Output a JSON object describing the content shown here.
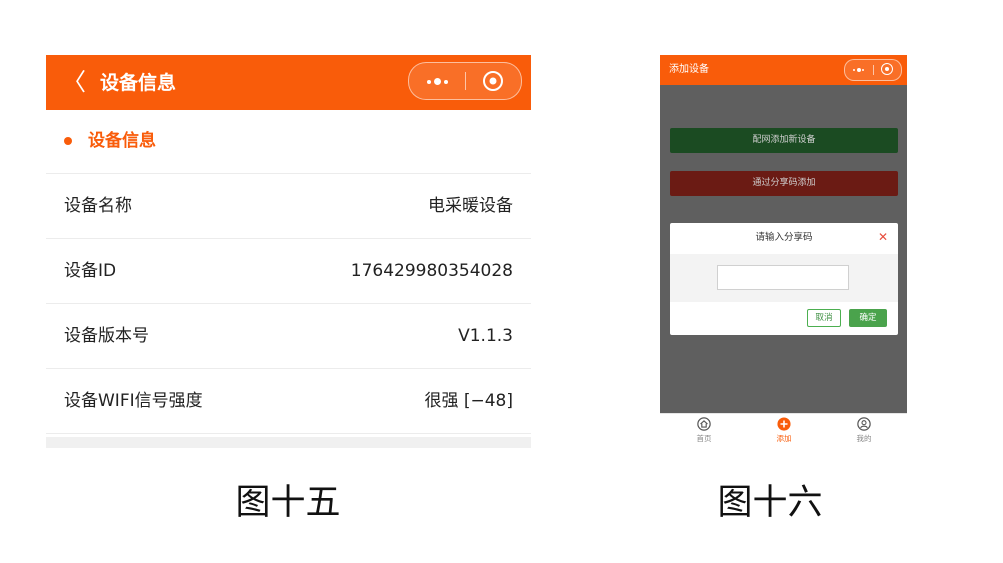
{
  "figure15": {
    "header": {
      "back_icon": "chevron-left-icon",
      "title": "设备信息"
    },
    "section_title": "设备信息",
    "rows": [
      {
        "label": "设备名称",
        "value": "电采暖设备"
      },
      {
        "label": "设备ID",
        "value": "176429980354028"
      },
      {
        "label": "设备版本号",
        "value": "V1.1.3"
      },
      {
        "label": "设备WIFI信号强度",
        "value": "很强 [−48]"
      }
    ],
    "caption": "图十五"
  },
  "figure16": {
    "header": {
      "title": "添加设备"
    },
    "buttons": {
      "network_add": "配网添加新设备",
      "share_add": "通过分享码添加"
    },
    "dialog": {
      "title": "请输入分享码",
      "input_value": "",
      "cancel": "取消",
      "confirm": "确定"
    },
    "tabbar": [
      {
        "label": "首页",
        "icon": "home-icon",
        "active": false
      },
      {
        "label": "添加",
        "icon": "plus-circle-icon",
        "active": true
      },
      {
        "label": "我的",
        "icon": "user-icon",
        "active": false
      }
    ],
    "caption": "图十六"
  },
  "colors": {
    "accent": "#f95c0a",
    "green_button": "#4aa34c",
    "close_red": "#e74c3c"
  }
}
